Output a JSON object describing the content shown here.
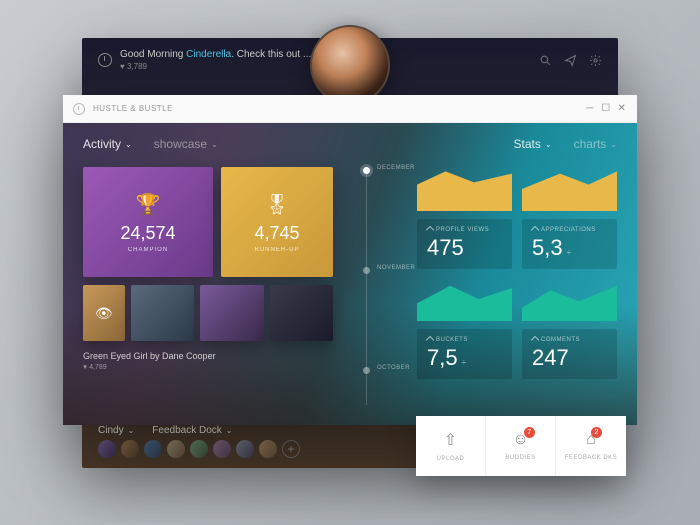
{
  "back": {
    "greeting_pre": "Good Morning ",
    "greeting_name": "Cinderella",
    "greeting_post": ". Check this out ...",
    "likes": "3,789",
    "bottom": {
      "user": "Cindy",
      "dock": "Feedback Dock"
    }
  },
  "window": {
    "title": "HUSTLE & BUSTLE"
  },
  "tabs": {
    "activity": "Activity",
    "showcase": "showcase",
    "stats": "Stats",
    "charts": "charts"
  },
  "tiles": {
    "champion": {
      "value": "24,574",
      "label": "CHAMPION"
    },
    "runnerup": {
      "value": "4,745",
      "label": "RUNNER-UP"
    }
  },
  "caption": {
    "title": "Green Eyed Girl by Dane Cooper",
    "likes": "4,789"
  },
  "timeline": {
    "dec": "DECEMBER",
    "nov": "NOVEMBER",
    "oct": "OCTOBER"
  },
  "stats": {
    "profile_views": {
      "label": "PROFILE VIEWS",
      "value": "475"
    },
    "appreciations": {
      "label": "APPRECIATIONS",
      "value": "5,3"
    },
    "buckets": {
      "label": "BUCKETS",
      "value": "7,5"
    },
    "comments": {
      "label": "COMMENTS",
      "value": "247"
    }
  },
  "actions": {
    "upload": "UPLOAD",
    "buddies": {
      "label": "BUDDIES",
      "badge": "7"
    },
    "feedback": {
      "label": "FEEDBACK DKS",
      "badge": "2"
    }
  }
}
